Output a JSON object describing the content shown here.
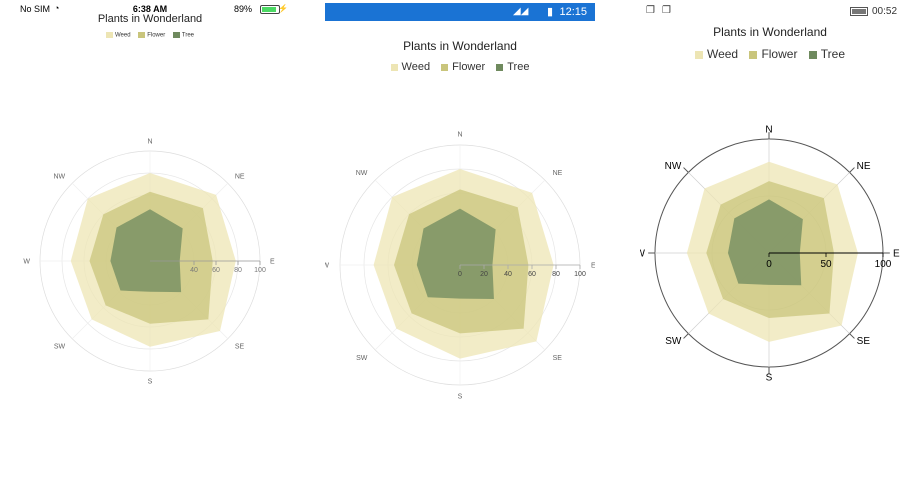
{
  "ios_status": {
    "carrier": "No SIM",
    "time": "6:38 AM",
    "battery": "89%"
  },
  "android_status": {
    "time": "12:15"
  },
  "windows_status": {
    "time": "00:52"
  },
  "colors": {
    "weed": "#EDE5B4",
    "flower": "#C9C57C",
    "tree": "#6F8A5E"
  },
  "chart_data": {
    "type": "radar",
    "title": "Plants in Wonderland",
    "categories": [
      "N",
      "NE",
      "E",
      "SE",
      "S",
      "SW",
      "W",
      "NW"
    ],
    "series": [
      {
        "name": "Weed",
        "values": [
          80,
          85,
          78,
          90,
          78,
          75,
          72,
          80
        ]
      },
      {
        "name": "Flower",
        "values": [
          63,
          68,
          57,
          75,
          57,
          57,
          55,
          60
        ]
      },
      {
        "name": "Tree",
        "values": [
          47,
          42,
          27,
          40,
          28,
          38,
          36,
          43
        ]
      }
    ],
    "legend": "top",
    "views": [
      {
        "platform": "iOS",
        "rlim": [
          0,
          100
        ],
        "ticks": [
          40,
          60,
          80,
          100
        ]
      },
      {
        "platform": "Android",
        "rlim": [
          0,
          100
        ],
        "ticks": [
          0,
          20,
          40,
          60,
          80,
          100
        ]
      },
      {
        "platform": "Windows",
        "rlim": [
          0,
          100
        ],
        "ticks": [
          0,
          50,
          100
        ]
      }
    ]
  }
}
